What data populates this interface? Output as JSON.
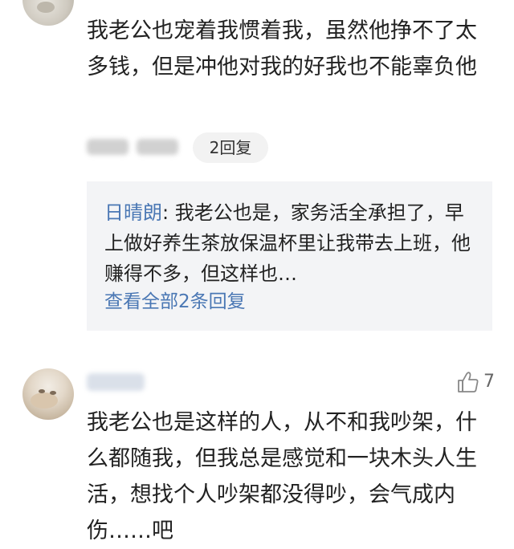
{
  "comments": [
    {
      "text": "我老公也宠着我惯着我，虽然他挣不了太多钱，但是冲他对我的好我也不能辜负他",
      "reply_button_label": "2回复",
      "reply_preview": {
        "author": "日晴朗",
        "separator": ": ",
        "text": "我老公也是，家务活全承担了，早上做好养生茶放保温杯里让我带去上班，他赚得不多，但这样也…",
        "view_all_label": "查看全部2条回复"
      }
    },
    {
      "text": "我老公也是这样的人，从不和我吵架，什么都随我，但我总是感觉和一块木头人生活，想找个人吵架都没得吵，会气成内伤……吧",
      "like_count": "7",
      "like_icon": "thumbs-up-icon"
    }
  ],
  "colors": {
    "link": "#4a77b4",
    "text": "#222222",
    "reply_bg": "#f3f4f6",
    "button_bg": "#f2f2f2"
  }
}
